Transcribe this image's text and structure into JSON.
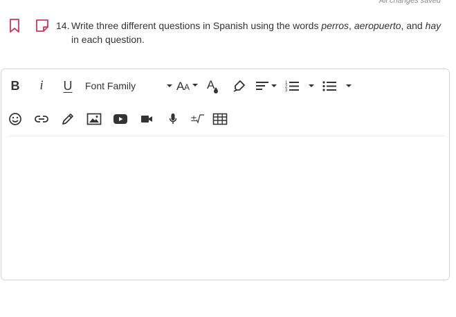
{
  "status": {
    "save_text": "All changes saved"
  },
  "question": {
    "number": "14.",
    "text_parts": [
      {
        "text": "Write three different questions in Spanish using the words ",
        "italic": false
      },
      {
        "text": "perros",
        "italic": true
      },
      {
        "text": ", ",
        "italic": false
      },
      {
        "text": "aeropuerto",
        "italic": true
      },
      {
        "text": ", and ",
        "italic": false
      },
      {
        "text": "hay",
        "italic": true
      },
      {
        "text": " in each question.",
        "italic": false
      }
    ],
    "icons": [
      "bookmark-icon",
      "note-icon"
    ],
    "icon_color": "#d0345a"
  },
  "editor": {
    "toolbar_row1": {
      "bold_label": "B",
      "italic_label": "i",
      "underline_label": "U",
      "font_family_label": "Font Family",
      "icons": [
        "font-size-icon",
        "text-color-icon",
        "highlight-icon",
        "align-icon",
        "ordered-list-icon",
        "unordered-list-icon"
      ]
    },
    "toolbar_row2": {
      "icons": [
        "emoji-icon",
        "link-icon",
        "pencil-icon",
        "image-icon",
        "youtube-icon",
        "video-icon",
        "microphone-icon",
        "math-icon",
        "table-icon"
      ]
    },
    "content": ""
  }
}
